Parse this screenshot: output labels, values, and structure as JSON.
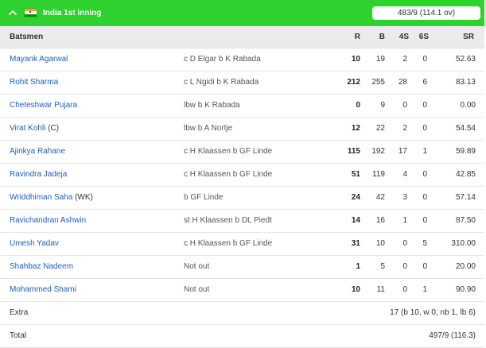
{
  "header": {
    "inning_title": "India 1st inning",
    "score_badge": "483/9 (114.1 ov)",
    "accent_color": "#2ed12e"
  },
  "columns": {
    "batsmen": "Batsmen",
    "runs": "R",
    "balls": "B",
    "fours": "4S",
    "sixes": "6S",
    "strike_rate": "SR"
  },
  "batsmen": [
    {
      "name": "Mayank Agarwal",
      "tag": "",
      "dismissal": "c D Elgar b K Rabada",
      "r": "10",
      "b": "19",
      "fours": "2",
      "sixes": "0",
      "sr": "52.63"
    },
    {
      "name": "Rohit Sharma",
      "tag": "",
      "dismissal": "c L Ngidi b K Rabada",
      "r": "212",
      "b": "255",
      "fours": "28",
      "sixes": "6",
      "sr": "83.13"
    },
    {
      "name": "Cheteshwar Pujara",
      "tag": "",
      "dismissal": "lbw b K Rabada",
      "r": "0",
      "b": "9",
      "fours": "0",
      "sixes": "0",
      "sr": "0.00"
    },
    {
      "name": "Virat Kohli",
      "tag": " (C)",
      "dismissal": "lbw b A Nortje",
      "r": "12",
      "b": "22",
      "fours": "2",
      "sixes": "0",
      "sr": "54.54"
    },
    {
      "name": "Ajinkya Rahane",
      "tag": "",
      "dismissal": "c H Klaassen b GF Linde",
      "r": "115",
      "b": "192",
      "fours": "17",
      "sixes": "1",
      "sr": "59.89"
    },
    {
      "name": "Ravindra Jadeja",
      "tag": "",
      "dismissal": "c H Klaassen b GF Linde",
      "r": "51",
      "b": "119",
      "fours": "4",
      "sixes": "0",
      "sr": "42.85"
    },
    {
      "name": "Wriddhiman Saha",
      "tag": " (WK)",
      "dismissal": "b GF Linde",
      "r": "24",
      "b": "42",
      "fours": "3",
      "sixes": "0",
      "sr": "57.14"
    },
    {
      "name": "Ravichandran Ashwin",
      "tag": "",
      "dismissal": "st H Klaassen b DL Piedt",
      "r": "14",
      "b": "16",
      "fours": "1",
      "sixes": "0",
      "sr": "87.50"
    },
    {
      "name": "Umesh Yadav",
      "tag": "",
      "dismissal": "c H Klaassen b GF Linde",
      "r": "31",
      "b": "10",
      "fours": "0",
      "sixes": "5",
      "sr": "310.00"
    },
    {
      "name": "Shahbaz Nadeem",
      "tag": "",
      "dismissal": "Not out",
      "r": "1",
      "b": "5",
      "fours": "0",
      "sixes": "0",
      "sr": "20.00"
    },
    {
      "name": "Mohammed Shami",
      "tag": "",
      "dismissal": "Not out",
      "r": "10",
      "b": "11",
      "fours": "0",
      "sixes": "1",
      "sr": "90.90"
    }
  ],
  "extra": {
    "label": "Extra",
    "value": "17 (b 10, w 0, nb 1, lb 6)"
  },
  "total": {
    "label": "Total",
    "value": "497/9 (116.3)"
  }
}
